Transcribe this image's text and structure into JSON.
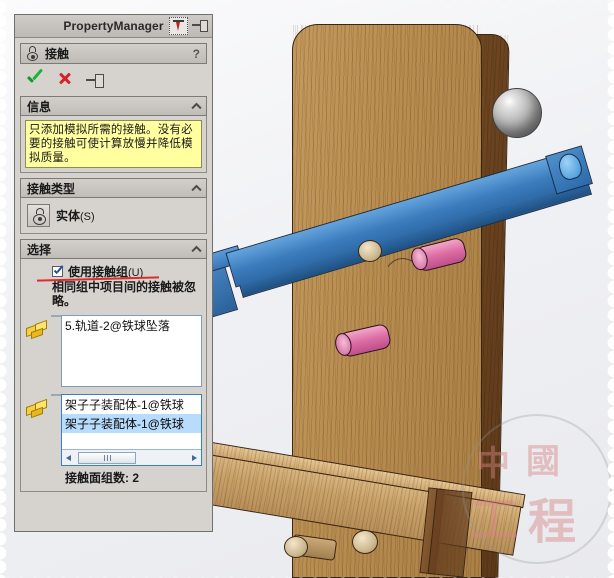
{
  "window": {
    "title": "PropertyManager",
    "titlebar_icons": [
      "flyout-icon",
      "pin-icon"
    ]
  },
  "command": {
    "icon": "contact-icon",
    "title": "接触",
    "help_label": "?",
    "actions": [
      {
        "name": "accept",
        "icon": "green-check-icon"
      },
      {
        "name": "cancel",
        "icon": "red-x-icon"
      },
      {
        "name": "pin",
        "icon": "pushpin-icon"
      }
    ]
  },
  "sections": {
    "info": {
      "title": "信息",
      "collapse_icon": "chevron-up-icon",
      "text": "只添加模拟所需的接触。没有必要的接触可使计算放慢并降低模拟质量。"
    },
    "contact_type": {
      "title": "接触类型",
      "collapse_icon": "chevron-up-icon",
      "option_icon": "solid-contact-icon",
      "option_label": "实体",
      "option_accelerator": "(S)"
    },
    "selection": {
      "title": "选择",
      "collapse_icon": "chevron-up-icon",
      "checkbox": {
        "checked": true,
        "label": "使用接触组",
        "accelerator": "(U)"
      },
      "note": "相同组中项目间的接触被忽略。",
      "group_1": {
        "icon": "face-selection-icon",
        "color": "#5aa5e8",
        "items": [
          "5.轨道-2@铁球坠落"
        ]
      },
      "group_2": {
        "icon": "face-selection-icon",
        "color": "#f781b4",
        "items": [
          "架子子装配体-1@铁球",
          "架子子装配体-1@铁球"
        ],
        "selected_index": 1,
        "scrollbar": {
          "left_arrow": "left-arrow-icon",
          "right_arrow": "right-arrow-icon"
        }
      },
      "count_label": "接触面组数: 2"
    }
  },
  "viewport": {
    "model_parts": [
      {
        "name": "wooden-post",
        "color": "#b98f52"
      },
      {
        "name": "wooden-post-side",
        "color": "#5e3a1a"
      },
      {
        "name": "blue-rail",
        "color": "#3c7cbd"
      },
      {
        "name": "pink-peg-upper",
        "color": "#dc6ca4"
      },
      {
        "name": "pink-peg-lower",
        "color": "#dc6ca4"
      },
      {
        "name": "steel-sphere",
        "color": "#b9b9b9"
      },
      {
        "name": "lower-beam",
        "color": "#c8a26a"
      },
      {
        "name": "wooden-dowel",
        "color": "#cdb98f"
      }
    ],
    "background_color": "#f0f1f4"
  },
  "watermark": {
    "chars": [
      "中",
      "國",
      "工",
      "程"
    ],
    "shape": "circle-seal"
  }
}
